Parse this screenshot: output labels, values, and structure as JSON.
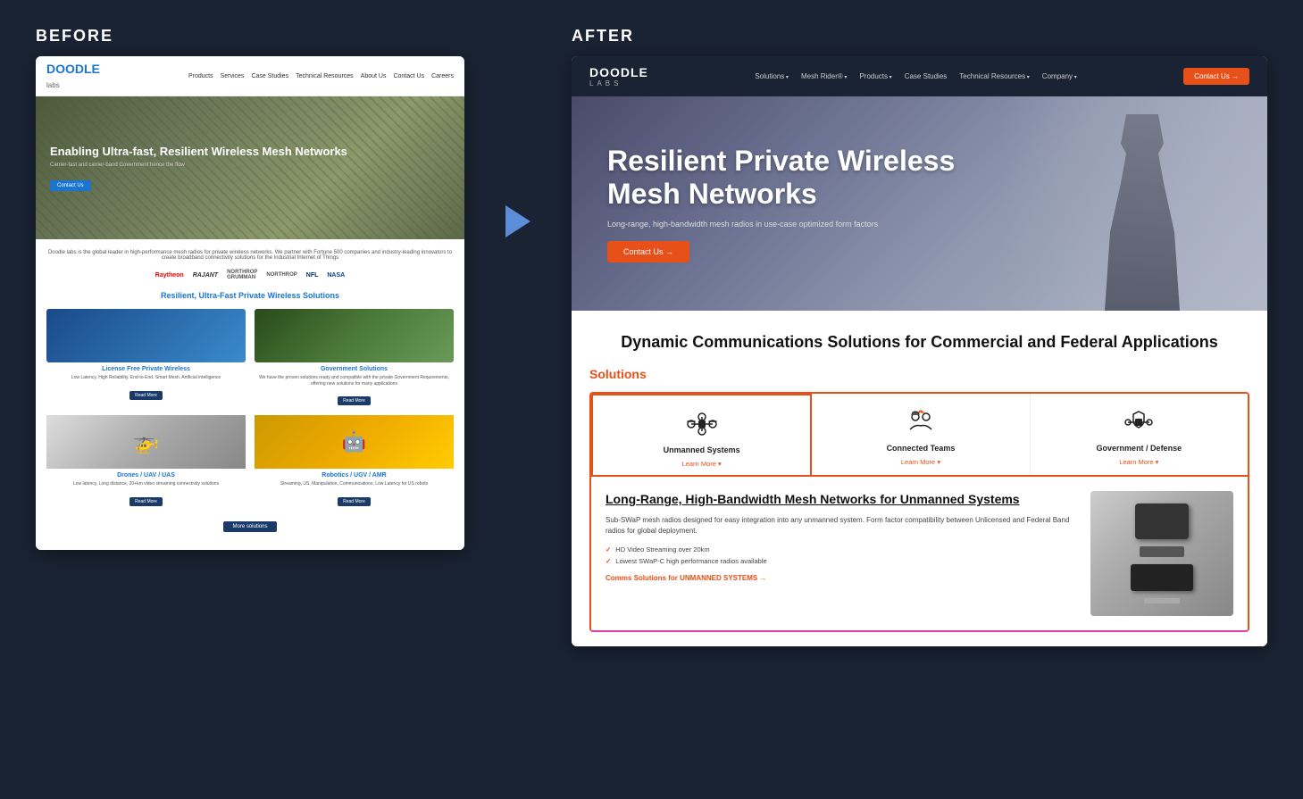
{
  "before": {
    "label": "BEFORE",
    "nav": {
      "logo": "DOODLE",
      "logo_sub": "labs",
      "links": [
        "Products",
        "Services",
        "Case Studies",
        "Technical Resources",
        "About Us",
        "Contact Us",
        "Careers"
      ]
    },
    "hero": {
      "title": "Enabling Ultra-fast, Resilient Wireless Mesh Networks",
      "subtitle": "Carrier-fast and carrier-band Government hence the flow",
      "cta": "Contact Us"
    },
    "tagline": "Doodle labs is the global leader in high-performance mesh radios for private wireless networks. We partner with Fortune 500 companies and industry-leading innovators to create broadband connectivity solutions for the Industrial Internet of Things",
    "logos": [
      "Raytheon",
      "RAJANT",
      "Northrop Grumman",
      "Northrop",
      "NFL",
      "NASA"
    ],
    "section_title": "Resilient, Ultra-Fast Private Wireless Solutions",
    "cards": [
      {
        "title": "License Free Private Wireless",
        "desc": "Low Latency. High Reliability. End-to-End. Smart Mesh. Artificial intelligence",
        "btn": "Read More",
        "img_type": "blue"
      },
      {
        "title": "Government Solutions",
        "desc": "We have the proven solutions ready and compatible with the private Government Requirements, offering new solutions for many applications",
        "btn": "Read More",
        "img_type": "green"
      },
      {
        "title": "Drones / UAV / UAS",
        "desc": "Low latency, Long distance, 20+km video streaming connectivity solutions",
        "btn": "Read More",
        "img_type": "gray"
      },
      {
        "title": "Robotics / UGV / AMR",
        "desc": "Streaming, US, Manipulation, Communications, Low Latency for US robots",
        "btn": "Read More",
        "img_type": "yellow"
      }
    ],
    "more_btn": "More solutions"
  },
  "arrow": {
    "title": "arrow-right"
  },
  "after": {
    "label": "AFTER",
    "nav": {
      "logo": "DOODLE",
      "logo_sub": "LABS",
      "links": [
        "Solutions",
        "Mesh Rider®",
        "Products",
        "Case Studies",
        "Technical Resources",
        "Company"
      ],
      "cta": "Contact Us"
    },
    "hero": {
      "title": "Resilient Private Wireless Mesh Networks",
      "subtitle": "Long-range, high-bandwidth mesh radios in use-case optimized form factors",
      "cta": "Contact Us"
    },
    "dynamic_title": "Dynamic Communications Solutions for Commercial and Federal Applications",
    "solutions_label": "Solutions",
    "solutions": [
      {
        "title": "Unmanned Systems",
        "learn": "Learn More",
        "active": true
      },
      {
        "title": "Connected Teams",
        "learn": "Learn More",
        "active": false
      },
      {
        "title": "Government / Defense",
        "learn": "Learn More",
        "active": false
      }
    ],
    "detail": {
      "title": "Long-Range, High-Bandwidth Mesh Networks for Unmanned Systems",
      "desc": "Sub-SWaP mesh radios designed for easy integration into any unmanned system. Form factor compatibility between Unlicensed and Federal Band radios for global deployment.",
      "features": [
        "HD Video Streaming over 20km",
        "Lowest SWaP-C high performance radios available"
      ],
      "cta": "Comms Solutions for UNMANNED SYSTEMS"
    }
  }
}
